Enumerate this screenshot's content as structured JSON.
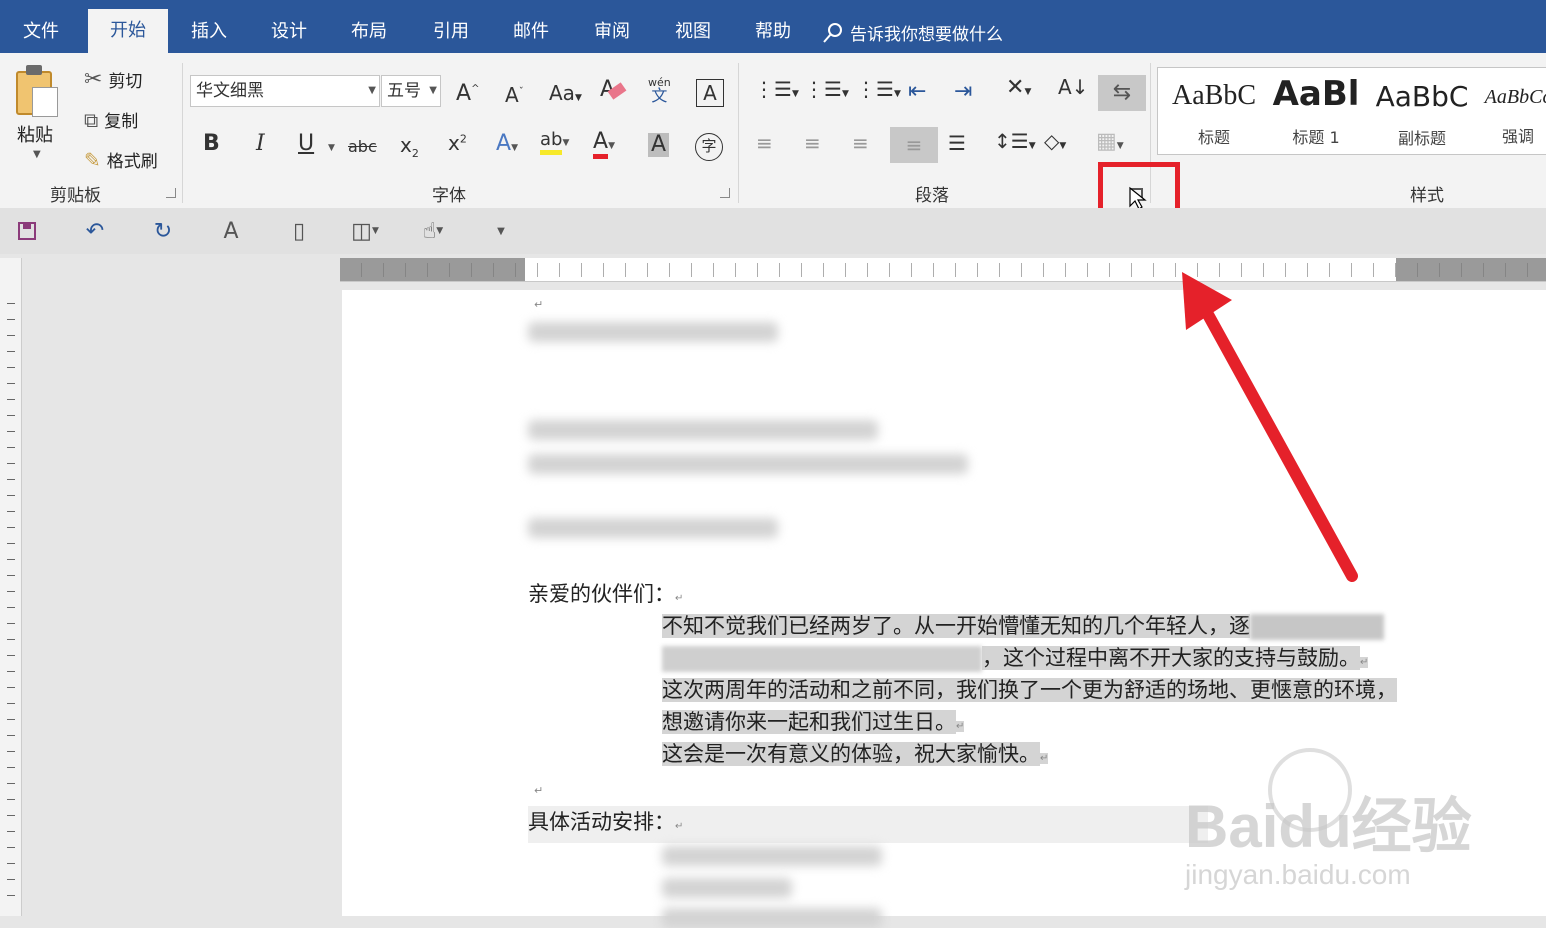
{
  "tabs": [
    {
      "label": "文件"
    },
    {
      "label": "开始",
      "active": true
    },
    {
      "label": "插入"
    },
    {
      "label": "设计"
    },
    {
      "label": "布局"
    },
    {
      "label": "引用"
    },
    {
      "label": "邮件"
    },
    {
      "label": "审阅"
    },
    {
      "label": "视图"
    },
    {
      "label": "帮助"
    }
  ],
  "tell_me": "告诉我你想要做什么",
  "clipboard": {
    "paste": "粘贴",
    "cut": "剪切",
    "copy": "复制",
    "format_painter": "格式刷",
    "group_label": "剪贴板"
  },
  "font": {
    "font_name": "华文细黑",
    "font_size": "五号",
    "change_case": "Aa",
    "phonetic_top": "wén",
    "phonetic_bottom": "文",
    "bold": "B",
    "italic": "I",
    "underline": "U",
    "strikethrough": "abc",
    "subscript": "x",
    "superscript": "x",
    "group_label": "字体"
  },
  "paragraph": {
    "group_label": "段落"
  },
  "styles": {
    "group_label": "样式",
    "items": [
      {
        "sample": "AaBbC",
        "name": "标题"
      },
      {
        "sample": "AaBl",
        "name": "标题 1"
      },
      {
        "sample": "AaBbC",
        "name": "副标题"
      },
      {
        "sample": "AaBbCc",
        "name": "强调"
      }
    ]
  },
  "document": {
    "greeting": "亲爱的伙伴们：",
    "body_lines": [
      "不知不觉我们已经两岁了。从一开始懵懂无知的几个年轻人，逐",
      "，这个过程中离不开大家的支持与鼓励。",
      "这次两周年的活动和之前不同，我们换了一个更为舒适的场地、更惬意的环境，",
      "想邀请你来一起和我们过生日。",
      "这会是一次有意义的体验，祝大家愉快。"
    ],
    "schedule_heading": "具体活动安排："
  },
  "watermark": {
    "brand": "Baidu经验",
    "url": "jingyan.baidu.com"
  },
  "colors": {
    "accent": "#2b579a",
    "highlight": "#e5212a"
  }
}
